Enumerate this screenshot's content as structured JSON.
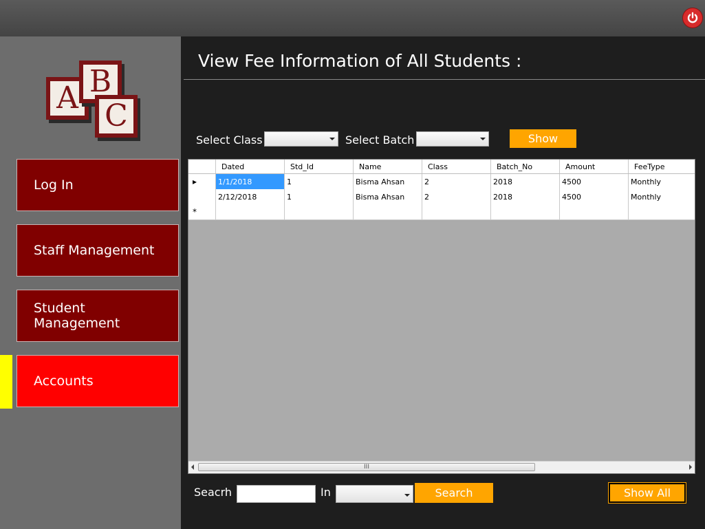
{
  "header": {
    "power_icon": "power-icon",
    "power_color": "#d72b2b"
  },
  "logo": {
    "letters": [
      "A",
      "B",
      "C"
    ],
    "color": "#7a1416"
  },
  "nav": [
    {
      "label": "Log In",
      "active": false
    },
    {
      "label": "Staff Management",
      "active": false
    },
    {
      "label": "Student Management",
      "active": false
    },
    {
      "label": "Accounts",
      "active": true
    }
  ],
  "colors": {
    "nav_bg": "#800000",
    "nav_active": "#ff0000",
    "indicator": "#ffff00",
    "button": "#ffa500"
  },
  "page": {
    "title": "View Fee Information of All Students :"
  },
  "filters": {
    "class_label": "Select Class",
    "class_value": "",
    "batch_label": "Select Batch",
    "batch_value": "",
    "show_label": "Show"
  },
  "grid": {
    "columns": [
      "Dated",
      "Std_Id",
      "Name",
      "Class",
      "Batch_No",
      "Amount",
      "FeeType"
    ],
    "rows": [
      [
        "1/1/2018",
        "1",
        "Bisma Ahsan",
        "2",
        "2018",
        "4500",
        "Monthly"
      ],
      [
        "2/12/2018",
        "1",
        "Bisma Ahsan",
        "2",
        "2018",
        "4500",
        "Monthly"
      ]
    ],
    "new_row_marker": "*",
    "current_row_marker": "▸",
    "scroll_grip": "III"
  },
  "search": {
    "label": "Seacrh",
    "value": "",
    "in_label": "In",
    "in_value": "",
    "search_button": "Search",
    "show_all_button": "Show All"
  }
}
